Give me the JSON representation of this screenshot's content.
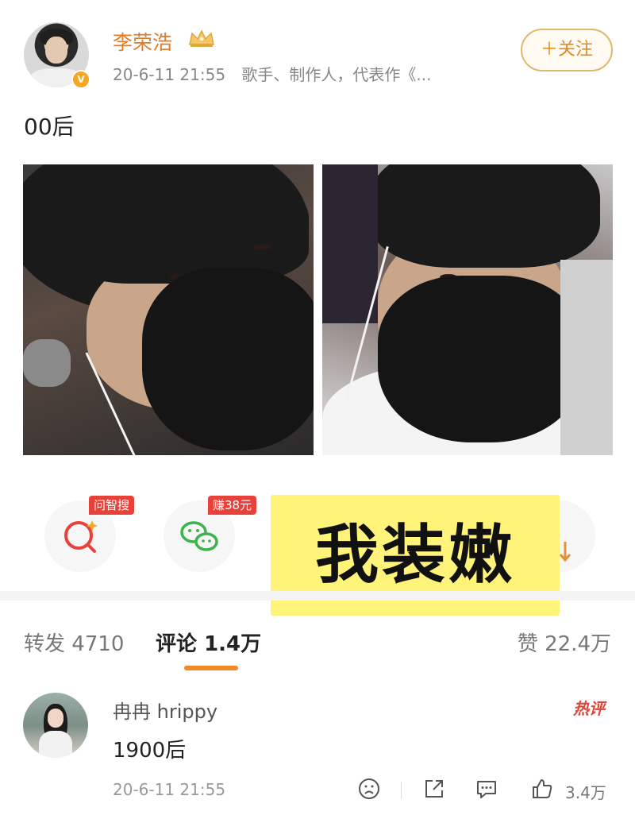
{
  "post": {
    "author": "李荣浩",
    "time": "20-6-11 21:55",
    "bio": "歌手、制作人，代表作《...",
    "follow_label": "＋关注",
    "text": "00后"
  },
  "actions": {
    "tag1": "问智搜",
    "tag2": "赚38元"
  },
  "overlay": {
    "text": "我装嫩"
  },
  "stats": {
    "repost_label": "转发",
    "repost_count": "4710",
    "comment_label": "评论",
    "comment_count": "1.4万",
    "like_label": "赞",
    "like_count": "22.4万"
  },
  "comment": {
    "user": "冉冉 hrippy",
    "badge": "热评",
    "text": "1900后",
    "time": "20-6-11 21:55",
    "like_count": "3.4万"
  },
  "colors": {
    "accent_orange": "#f08a24",
    "username_orange": "#e07b28",
    "tag_red": "#e8413a",
    "overlay_yellow": "#fff37a"
  }
}
